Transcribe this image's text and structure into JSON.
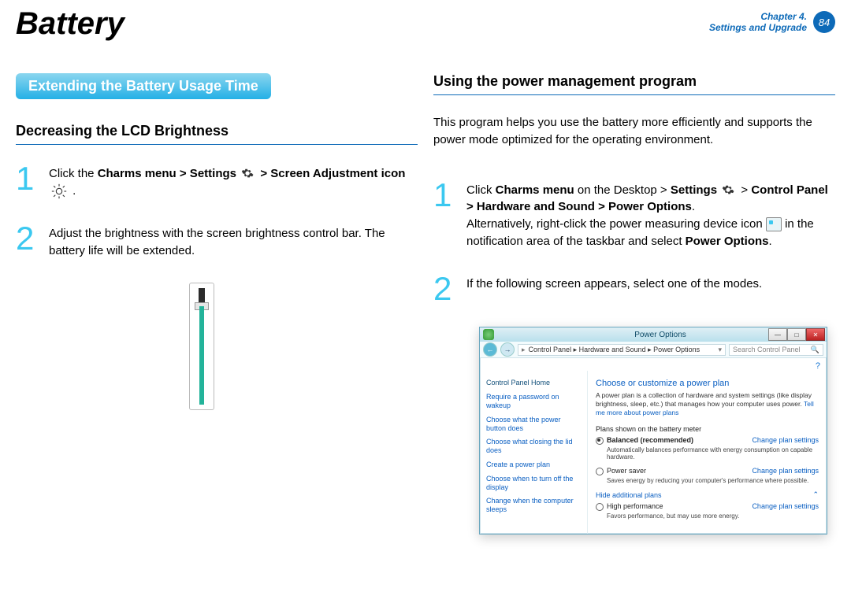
{
  "header": {
    "title": "Battery",
    "chapter_line1": "Chapter 4.",
    "chapter_line2": "Settings and Upgrade",
    "page_number": "84"
  },
  "left": {
    "section_title": "Extending the Battery Usage Time",
    "subheading": "Decreasing the LCD Brightness",
    "step1_num": "1",
    "step1_pre": "Click the ",
    "step1_bold1": "Charms menu > Settings ",
    "step1_post1": " > ",
    "step1_bold2": "Screen Adjustment icon ",
    "step1_end": " .",
    "step2_num": "2",
    "step2_text": "Adjust the brightness with the screen brightness control bar. The battery life will be extended."
  },
  "right": {
    "subheading": "Using the power management program",
    "intro": "This program helps you use the battery more efficiently and supports the power mode optimized for the operating environment.",
    "step1_num": "1",
    "step1_pre": "Click ",
    "step1_bold1": "Charms menu",
    "step1_mid1": " on the Desktop > ",
    "step1_bold2": "Settings ",
    "step1_post_icon": " > ",
    "step1_bold3": "Control Panel > Hardware and Sound > Power Options",
    "step1_period": ".",
    "step1_alt": "Alternatively, right-click the power measuring device icon ",
    "step1_alt2": " in the notification area of the taskbar and select ",
    "step1_bold4": "Power Options",
    "step1_alt_end": ".",
    "step2_num": "2",
    "step2_text": "If the following screen appears, select one of the modes."
  },
  "window": {
    "title": "Power Options",
    "btn_min": "—",
    "btn_max": "□",
    "btn_close": "✕",
    "back_arrow": "←",
    "fwd_arrow": "→",
    "crumbs": "Control Panel  ▸  Hardware and Sound  ▸  Power Options",
    "crumbs_chevron": "▾",
    "search_placeholder": "Search Control Panel",
    "help_icon": "?",
    "side": {
      "home": "Control Panel Home",
      "l1": "Require a password on wakeup",
      "l2": "Choose what the power button does",
      "l3": "Choose what closing the lid does",
      "l4": "Create a power plan",
      "l5": "Choose when to turn off the display",
      "l6": "Change when the computer sleeps"
    },
    "main": {
      "heading": "Choose or customize a power plan",
      "desc_pre": "A power plan is a collection of hardware and system settings (like display brightness, sleep, etc.) that manages how your computer uses power. ",
      "desc_link": "Tell me more about power plans",
      "plans_label": "Plans shown on the battery meter",
      "plan1_name": "Balanced (recommended)",
      "plan1_desc": "Automatically balances performance with energy consumption on capable hardware.",
      "plan2_name": "Power saver",
      "plan2_desc": "Saves energy by reducing your computer's performance where possible.",
      "change_link": "Change plan settings",
      "hide_label": "Hide additional plans",
      "hide_chevron": "⌃",
      "plan3_name": "High performance",
      "plan3_desc": "Favors performance, but may use more energy."
    }
  }
}
